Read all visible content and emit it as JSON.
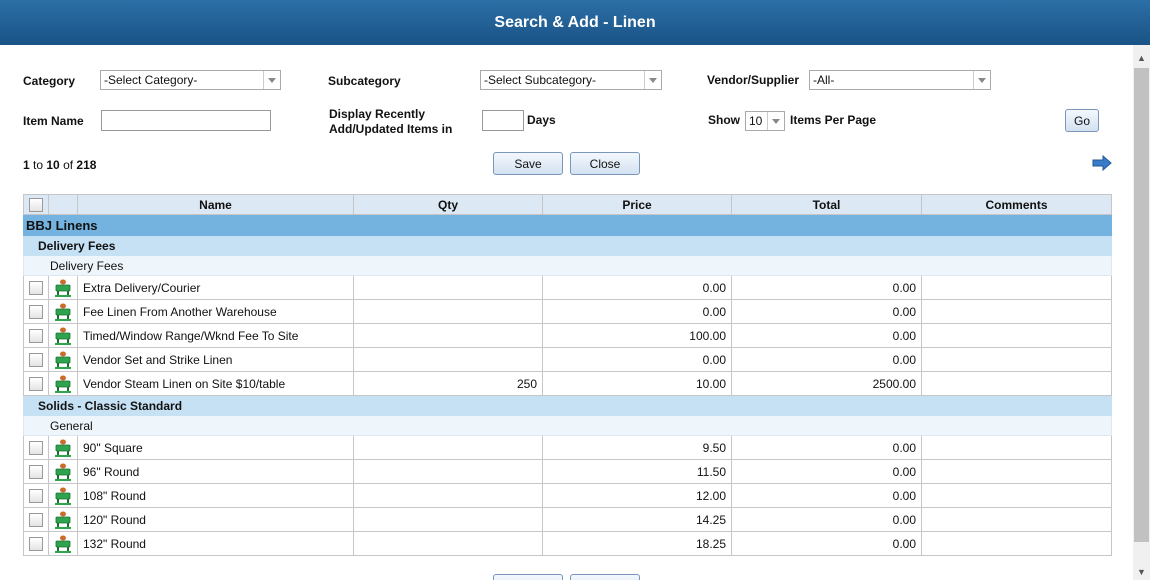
{
  "title": "Search & Add - Linen",
  "filters": {
    "category_label": "Category",
    "category_value": "-Select Category-",
    "subcategory_label": "Subcategory",
    "subcategory_value": "-Select Subcategory-",
    "vendor_label": "Vendor/Supplier",
    "vendor_value": "-All-",
    "item_name_label": "Item Name",
    "item_name_value": "",
    "recent_label_1": "Display Recently",
    "recent_label_2": "Add/Updated Items in",
    "days_value": "",
    "days_label": "Days",
    "show_label": "Show",
    "per_page_value": "10",
    "per_page_label": "Items Per Page",
    "go_label": "Go"
  },
  "pager": {
    "start": "1",
    "to": " to ",
    "end": "10",
    "of": " of ",
    "total": "218"
  },
  "actions": {
    "save_label": "Save",
    "close_label": "Close"
  },
  "table": {
    "headers": {
      "name": "Name",
      "qty": "Qty",
      "price": "Price",
      "total": "Total",
      "comments": "Comments"
    },
    "vendor": "BBJ Linens",
    "groups": [
      {
        "category": "Delivery Fees",
        "subcategory": "Delivery Fees",
        "rows": [
          {
            "name": "Extra Delivery/Courier",
            "qty": "",
            "price": "0.00",
            "total": "0.00",
            "comments": ""
          },
          {
            "name": "Fee Linen From Another Warehouse",
            "qty": "",
            "price": "0.00",
            "total": "0.00",
            "comments": ""
          },
          {
            "name": "Timed/Window Range/Wknd Fee To Site",
            "qty": "",
            "price": "100.00",
            "total": "0.00",
            "comments": ""
          },
          {
            "name": "Vendor Set and Strike Linen",
            "qty": "",
            "price": "0.00",
            "total": "0.00",
            "comments": ""
          },
          {
            "name": "Vendor Steam Linen on Site $10/table",
            "qty": "250",
            "price": "10.00",
            "total": "2500.00",
            "comments": ""
          }
        ]
      },
      {
        "category": "Solids - Classic Standard",
        "subcategory": "General",
        "rows": [
          {
            "name": "90\" Square",
            "qty": "",
            "price": "9.50",
            "total": "0.00",
            "comments": ""
          },
          {
            "name": "96\" Round",
            "qty": "",
            "price": "11.50",
            "total": "0.00",
            "comments": ""
          },
          {
            "name": "108\" Round",
            "qty": "",
            "price": "12.00",
            "total": "0.00",
            "comments": ""
          },
          {
            "name": "120\" Round",
            "qty": "",
            "price": "14.25",
            "total": "0.00",
            "comments": ""
          },
          {
            "name": "132\" Round",
            "qty": "",
            "price": "18.25",
            "total": "0.00",
            "comments": ""
          }
        ]
      }
    ]
  },
  "icons": {
    "next": "arrow-right-icon",
    "row_item": "linen-table-icon"
  },
  "colors": {
    "titlebar": "#1f5f94",
    "vendor_row": "#74b3df",
    "category_row": "#c6e0f4",
    "header": "#dce8f4"
  }
}
